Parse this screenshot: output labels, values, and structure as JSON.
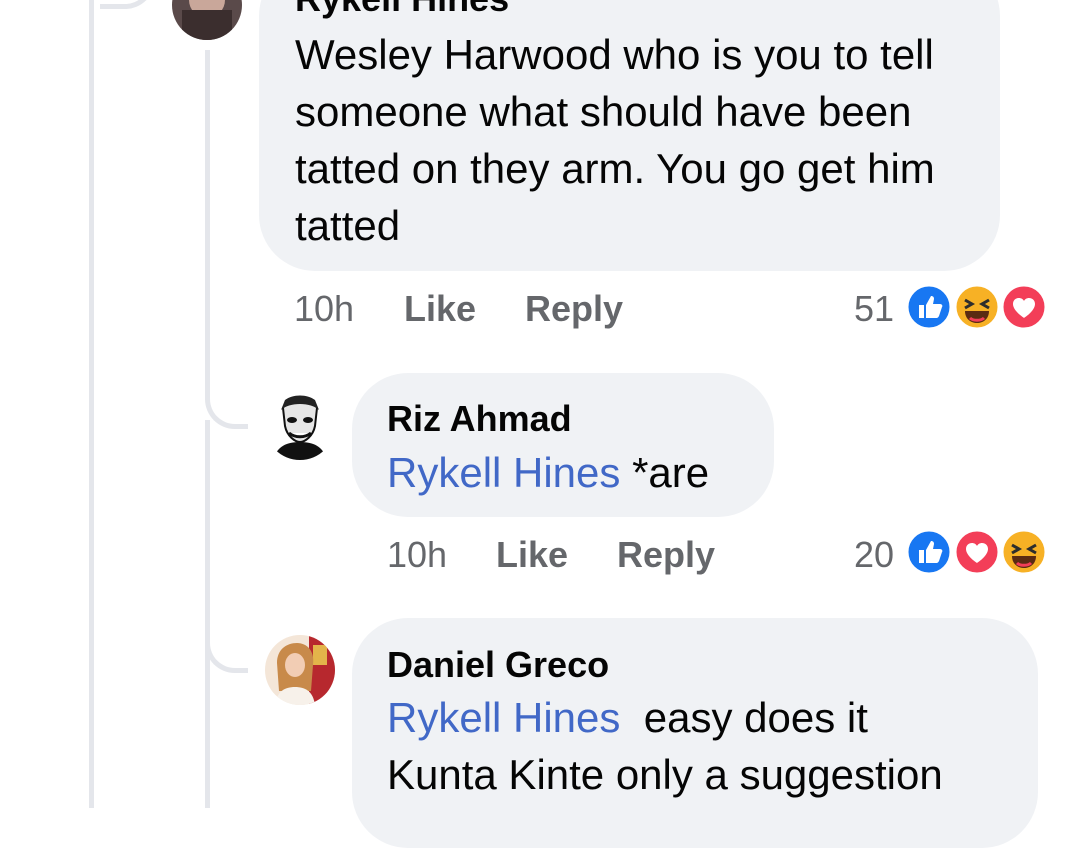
{
  "comments": [
    {
      "author": "Rykell Hines",
      "text": "Wesley Harwood  who is you to tell someone what should have been tatted on they arm. You go get him tatted",
      "time": "10h",
      "like_label": "Like",
      "reply_label": "Reply",
      "reaction_count": "51",
      "reactions": [
        "like",
        "haha",
        "love"
      ]
    },
    {
      "author": "Riz Ahmad",
      "mention": "Rykell Hines",
      "text": " *are",
      "time": "10h",
      "like_label": "Like",
      "reply_label": "Reply",
      "reaction_count": "20",
      "reactions": [
        "like",
        "love",
        "haha"
      ]
    },
    {
      "author": "Daniel Greco",
      "mention": "Rykell Hines",
      "text_line1": "  easy does it",
      "text_line2": "Kunta Kinte only a suggestion"
    }
  ],
  "colors": {
    "bubble": "#f0f2f5",
    "mention": "#4168c7",
    "meta": "#65676b",
    "like_blue": "#1877f2",
    "love_red": "#f33e58",
    "haha_yellow": "#f7b125"
  }
}
